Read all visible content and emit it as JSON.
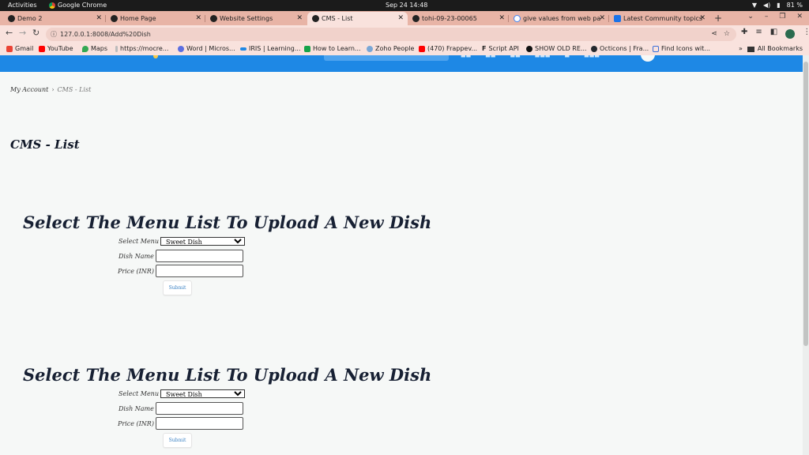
{
  "system": {
    "activities": "Activities",
    "app_name": "Google Chrome",
    "clock": "Sep 24  14:48",
    "battery": "81 %"
  },
  "tabs": [
    {
      "title": "Demo 2",
      "active": false
    },
    {
      "title": "Home Page",
      "active": false
    },
    {
      "title": "Website Settings",
      "active": false
    },
    {
      "title": "CMS - List",
      "active": true
    },
    {
      "title": "tohi-09-23-00065",
      "active": false
    },
    {
      "title": "give values from web pa",
      "active": false
    },
    {
      "title": "Latest Community topics",
      "active": false
    }
  ],
  "url": "127.0.0.1:8008/Add%20Dish",
  "bookmarks": [
    "Gmail",
    "YouTube",
    "Maps",
    "https://mocre...",
    "Word | Micros...",
    "IRIS | Learning...",
    "How to Learn...",
    "Zoho People",
    "(470) Frappev...",
    "Script API",
    "SHOW OLD RE...",
    "Octicons | Fra...",
    "Find Icons wit..."
  ],
  "all_bookmarks": "All Bookmarks",
  "breadcrumb": {
    "parent": "My Account",
    "current": "CMS - List"
  },
  "page_title": "CMS - List",
  "forms": [
    {
      "heading": "Select The Menu List To Upload A New Dish",
      "menu_label": "Select Menu",
      "menu_value": "Sweet Dish",
      "name_label": "Dish Name",
      "name_value": "",
      "price_label": "Price (INR)",
      "price_value": "",
      "submit_label": "Submit"
    },
    {
      "heading": "Select The Menu List To Upload A New Dish",
      "menu_label": "Select Menu",
      "menu_value": "Sweet Dish",
      "name_label": "Dish Name",
      "name_value": "",
      "price_label": "Price (INR)",
      "price_value": "",
      "submit_label": "Submit"
    }
  ],
  "colors": {
    "site_nav": "#1e88e5",
    "tab_strip": "#e8b4a6",
    "toolbar": "#f9e2dd",
    "page_bg": "#f6f8f7"
  }
}
